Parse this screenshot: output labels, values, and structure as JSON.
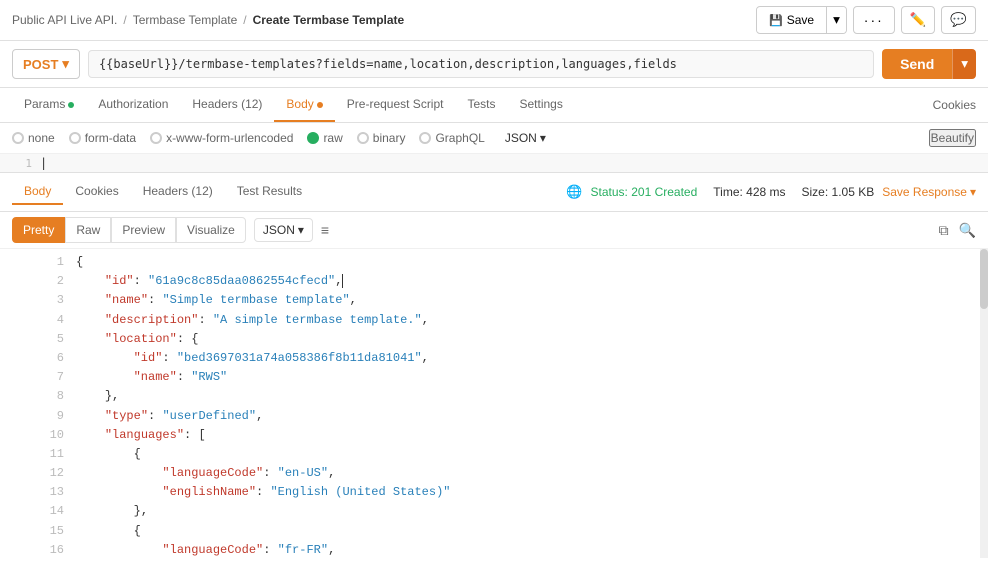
{
  "breadcrumb": {
    "part1": "Public API Live API.",
    "sep1": "/",
    "part2": "Termbase Template",
    "sep2": "/",
    "current": "Create Termbase Template"
  },
  "toolbar": {
    "save_label": "Save",
    "more_label": "···"
  },
  "url_bar": {
    "method": "POST",
    "url": "{{baseUrl}}/termbase-templates?fields=name,location,description,languages,fields",
    "send_label": "Send"
  },
  "tabs": [
    {
      "id": "params",
      "label": "Params",
      "dot": "green"
    },
    {
      "id": "authorization",
      "label": "Authorization",
      "dot": null
    },
    {
      "id": "headers",
      "label": "Headers (12)",
      "dot": null
    },
    {
      "id": "body",
      "label": "Body",
      "dot": "orange",
      "active": true
    },
    {
      "id": "pre-request",
      "label": "Pre-request Script",
      "dot": null
    },
    {
      "id": "tests",
      "label": "Tests",
      "dot": null
    },
    {
      "id": "settings",
      "label": "Settings",
      "dot": null
    }
  ],
  "cookies_link": "Cookies",
  "body_formats": [
    {
      "id": "none",
      "label": "none",
      "selected": false
    },
    {
      "id": "form-data",
      "label": "form-data",
      "selected": false
    },
    {
      "id": "urlencoded",
      "label": "x-www-form-urlencoded",
      "selected": false
    },
    {
      "id": "raw",
      "label": "raw",
      "selected": true
    },
    {
      "id": "binary",
      "label": "binary",
      "selected": false
    },
    {
      "id": "graphql",
      "label": "GraphQL",
      "selected": false
    }
  ],
  "json_format": "JSON",
  "beautify": "Beautify",
  "response": {
    "status": "Status: 201 Created",
    "time": "Time: 428 ms",
    "size": "Size: 1.05 KB",
    "save_response": "Save Response"
  },
  "response_tabs": [
    {
      "id": "body",
      "label": "Body",
      "active": true
    },
    {
      "id": "cookies",
      "label": "Cookies"
    },
    {
      "id": "headers",
      "label": "Headers (12)"
    },
    {
      "id": "test_results",
      "label": "Test Results"
    }
  ],
  "view_tabs": [
    {
      "id": "pretty",
      "label": "Pretty",
      "active": true
    },
    {
      "id": "raw",
      "label": "Raw"
    },
    {
      "id": "preview",
      "label": "Preview"
    },
    {
      "id": "visualize",
      "label": "Visualize"
    }
  ],
  "json_view_format": "JSON",
  "json_lines": [
    {
      "num": 1,
      "content": "{"
    },
    {
      "num": 2,
      "content": "    \"id\": \"61a9c8c85daa0862554cfecd\","
    },
    {
      "num": 3,
      "content": "    \"name\": \"Simple termbase template\","
    },
    {
      "num": 4,
      "content": "    \"description\": \"A simple termbase template.\","
    },
    {
      "num": 5,
      "content": "    \"location\": {"
    },
    {
      "num": 6,
      "content": "        \"id\": \"bed3697031a74a058386f8b11da81041\","
    },
    {
      "num": 7,
      "content": "        \"name\": \"RWS\""
    },
    {
      "num": 8,
      "content": "    },"
    },
    {
      "num": 9,
      "content": "    \"type\": \"userDefined\","
    },
    {
      "num": 10,
      "content": "    \"languages\": ["
    },
    {
      "num": 11,
      "content": "        {"
    },
    {
      "num": 12,
      "content": "            \"languageCode\": \"en-US\","
    },
    {
      "num": 13,
      "content": "            \"englishName\": \"English (United States)\""
    },
    {
      "num": 14,
      "content": "        },"
    },
    {
      "num": 15,
      "content": "        {"
    },
    {
      "num": 16,
      "content": "            \"languageCode\": \"fr-FR\","
    }
  ]
}
